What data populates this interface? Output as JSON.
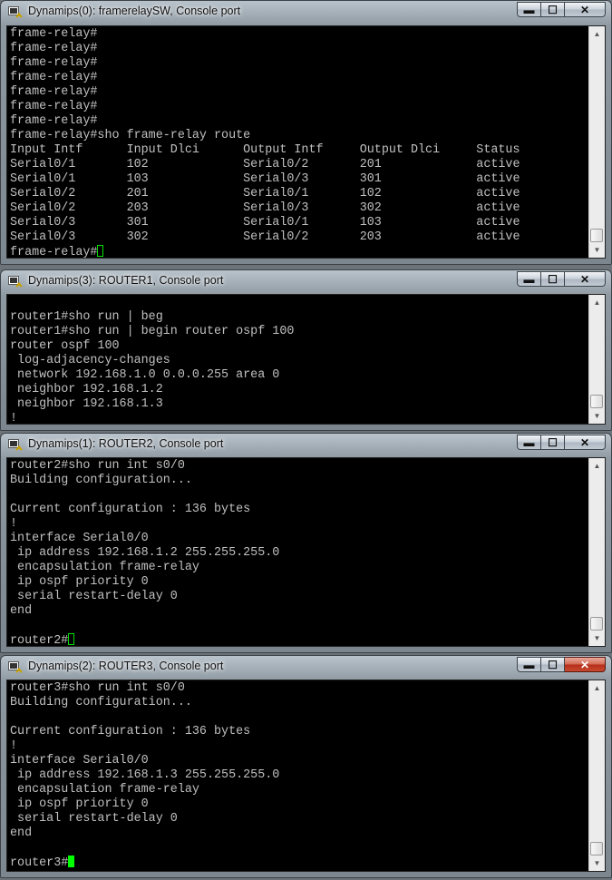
{
  "windows": [
    {
      "title": "Dynamips(0): framerelaySW, Console port",
      "lines": [
        "frame-relay#",
        "frame-relay#",
        "frame-relay#",
        "frame-relay#",
        "frame-relay#",
        "frame-relay#",
        "frame-relay#",
        "frame-relay#sho frame-relay route",
        "Input Intf      Input Dlci      Output Intf     Output Dlci     Status",
        "Serial0/1       102             Serial0/2       201             active",
        "Serial0/1       103             Serial0/3       301             active",
        "Serial0/2       201             Serial0/1       102             active",
        "Serial0/2       203             Serial0/3       302             active",
        "Serial0/3       301             Serial0/1       103             active",
        "Serial0/3       302             Serial0/2       203             active"
      ],
      "prompt": "frame-relay#"
    },
    {
      "title": "Dynamips(3): ROUTER1, Console port",
      "lines": [
        "",
        "router1#sho run | beg",
        "router1#sho run | begin router ospf 100",
        "router ospf 100",
        " log-adjacency-changes",
        " network 192.168.1.0 0.0.0.255 area 0",
        " neighbor 192.168.1.2",
        " neighbor 192.168.1.3",
        "!"
      ]
    },
    {
      "title": "Dynamips(1): ROUTER2, Console port",
      "lines": [
        "router2#sho run int s0/0",
        "Building configuration...",
        "",
        "Current configuration : 136 bytes",
        "!",
        "interface Serial0/0",
        " ip address 192.168.1.2 255.255.255.0",
        " encapsulation frame-relay",
        " ip ospf priority 0",
        " serial restart-delay 0",
        "end",
        ""
      ],
      "prompt": "router2#"
    },
    {
      "title": "Dynamips(2): ROUTER3, Console port",
      "lines": [
        "router3#sho run int s0/0",
        "Building configuration...",
        "",
        "Current configuration : 136 bytes",
        "!",
        "interface Serial0/0",
        " ip address 192.168.1.3 255.255.255.0",
        " encapsulation frame-relay",
        " ip ospf priority 0",
        " serial restart-delay 0",
        "end",
        ""
      ],
      "prompt": "router3#"
    }
  ],
  "window_controls": {
    "minimize": "▬",
    "maximize": "☐",
    "close": "✕"
  },
  "scrollbar_arrows": {
    "up": "▲",
    "down": "▼"
  },
  "icons": {
    "window_icon": "console-app-icon"
  },
  "colors": {
    "console_bg": "#000000",
    "console_text": "#c0c0c0",
    "cursor": "#00ff00",
    "close_active": "#c84a30"
  }
}
